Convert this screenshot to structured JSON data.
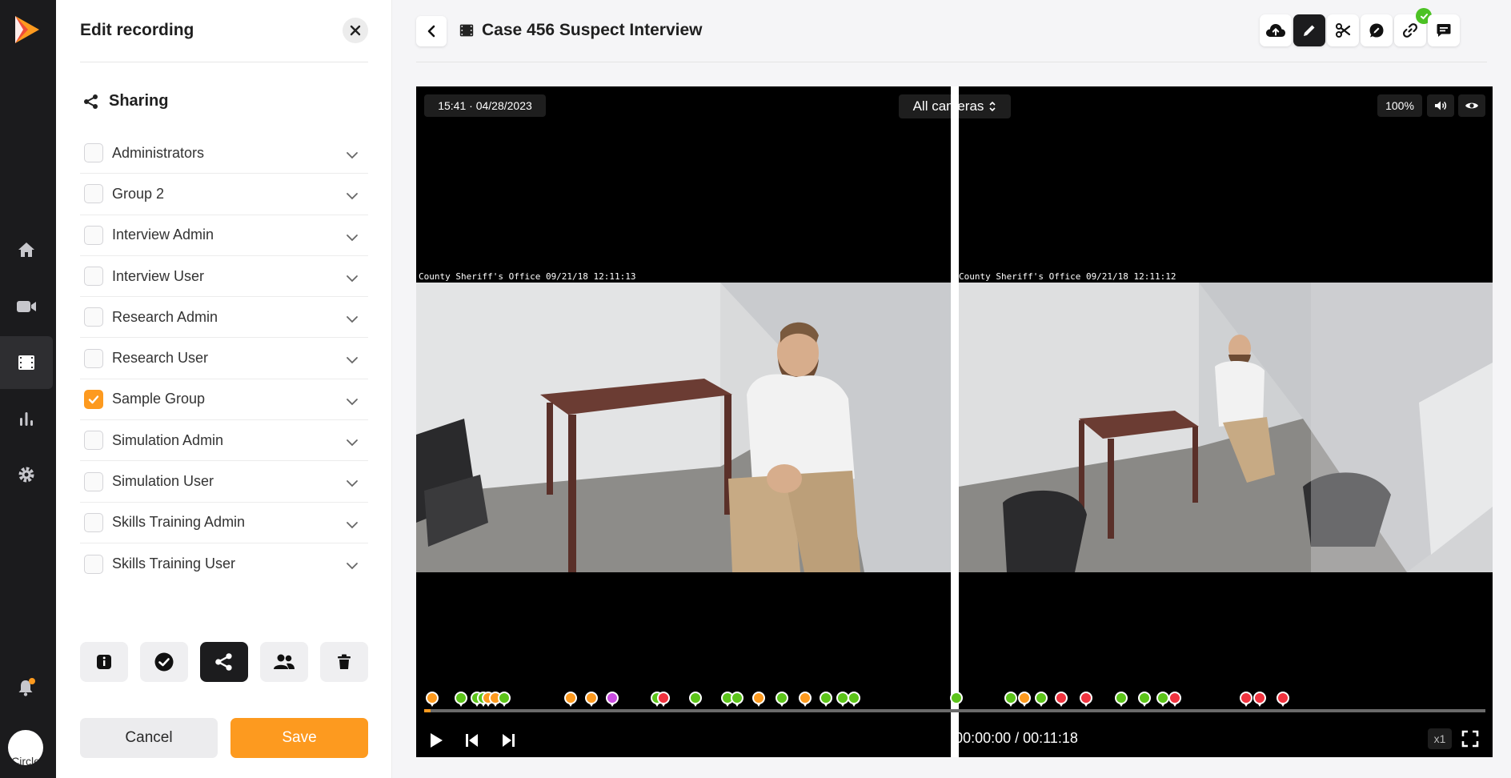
{
  "sidebar": {
    "logo": "play-logo-icon",
    "nav": [
      "home-icon",
      "video-icon",
      "film-icon",
      "chart-icon",
      "gear-icon"
    ],
    "active_nav": "film-icon",
    "notification_color": "#fd9a1f",
    "avatar_alt": "Circle"
  },
  "panel": {
    "title": "Edit recording",
    "section_title": "Sharing",
    "groups": [
      {
        "label": "Administrators",
        "checked": false
      },
      {
        "label": "Group 2",
        "checked": false
      },
      {
        "label": "Interview Admin",
        "checked": false
      },
      {
        "label": "Interview User",
        "checked": false
      },
      {
        "label": "Research Admin",
        "checked": false
      },
      {
        "label": "Research User",
        "checked": false
      },
      {
        "label": "Sample Group",
        "checked": true
      },
      {
        "label": "Simulation Admin",
        "checked": false
      },
      {
        "label": "Simulation User",
        "checked": false
      },
      {
        "label": "Skills Training Admin",
        "checked": false
      },
      {
        "label": "Skills Training User",
        "checked": false
      }
    ],
    "tools": [
      "info-icon",
      "check-circle-icon",
      "share-icon",
      "users-icon",
      "trash-icon"
    ],
    "active_tool": "share-icon",
    "cancel_label": "Cancel",
    "save_label": "Save",
    "accent": "#fd9a1f"
  },
  "header": {
    "title": "Case 456 Suspect Interview",
    "tools": [
      "upload-icon",
      "pencil-icon",
      "scissors-icon",
      "edit-note-icon",
      "link-icon",
      "comment-icon"
    ],
    "active_tool": "pencil-icon"
  },
  "player": {
    "datetime": "15:41 · 04/28/2023",
    "camera_select": "All cameras",
    "zoom": "100%",
    "cam1_overlay": "County Sheriff's Office 09/21/18 12:11:13",
    "cam2_overlay": "County Sheriff's Office 09/21/18 12:11:12",
    "time_current": "00:00:00",
    "time_total": "00:11:18",
    "time_text": "00:00:00 / 00:11:18",
    "speed": "x1",
    "marker_colors": {
      "green": "#5cc41a",
      "orange": "#fd9a1f",
      "red": "#f0333f",
      "purple": "#c94de0"
    }
  }
}
